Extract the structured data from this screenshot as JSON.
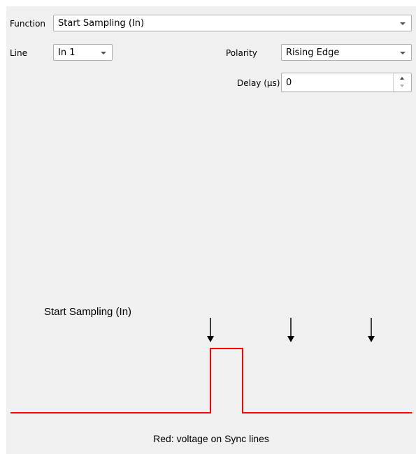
{
  "function": {
    "label": "Function",
    "value": "Start Sampling (In)"
  },
  "line": {
    "label": "Line",
    "value": "In 1"
  },
  "polarity": {
    "label": "Polarity",
    "value": "Rising Edge"
  },
  "delay": {
    "label": "Delay (µs)",
    "value": "0"
  },
  "diagram": {
    "title": "Start Sampling (In)",
    "caption": "Red: voltage on Sync lines",
    "signal_color": "#ff0000",
    "arrow_color": "#000000",
    "marker_count": 3,
    "pulse_count": 1
  }
}
